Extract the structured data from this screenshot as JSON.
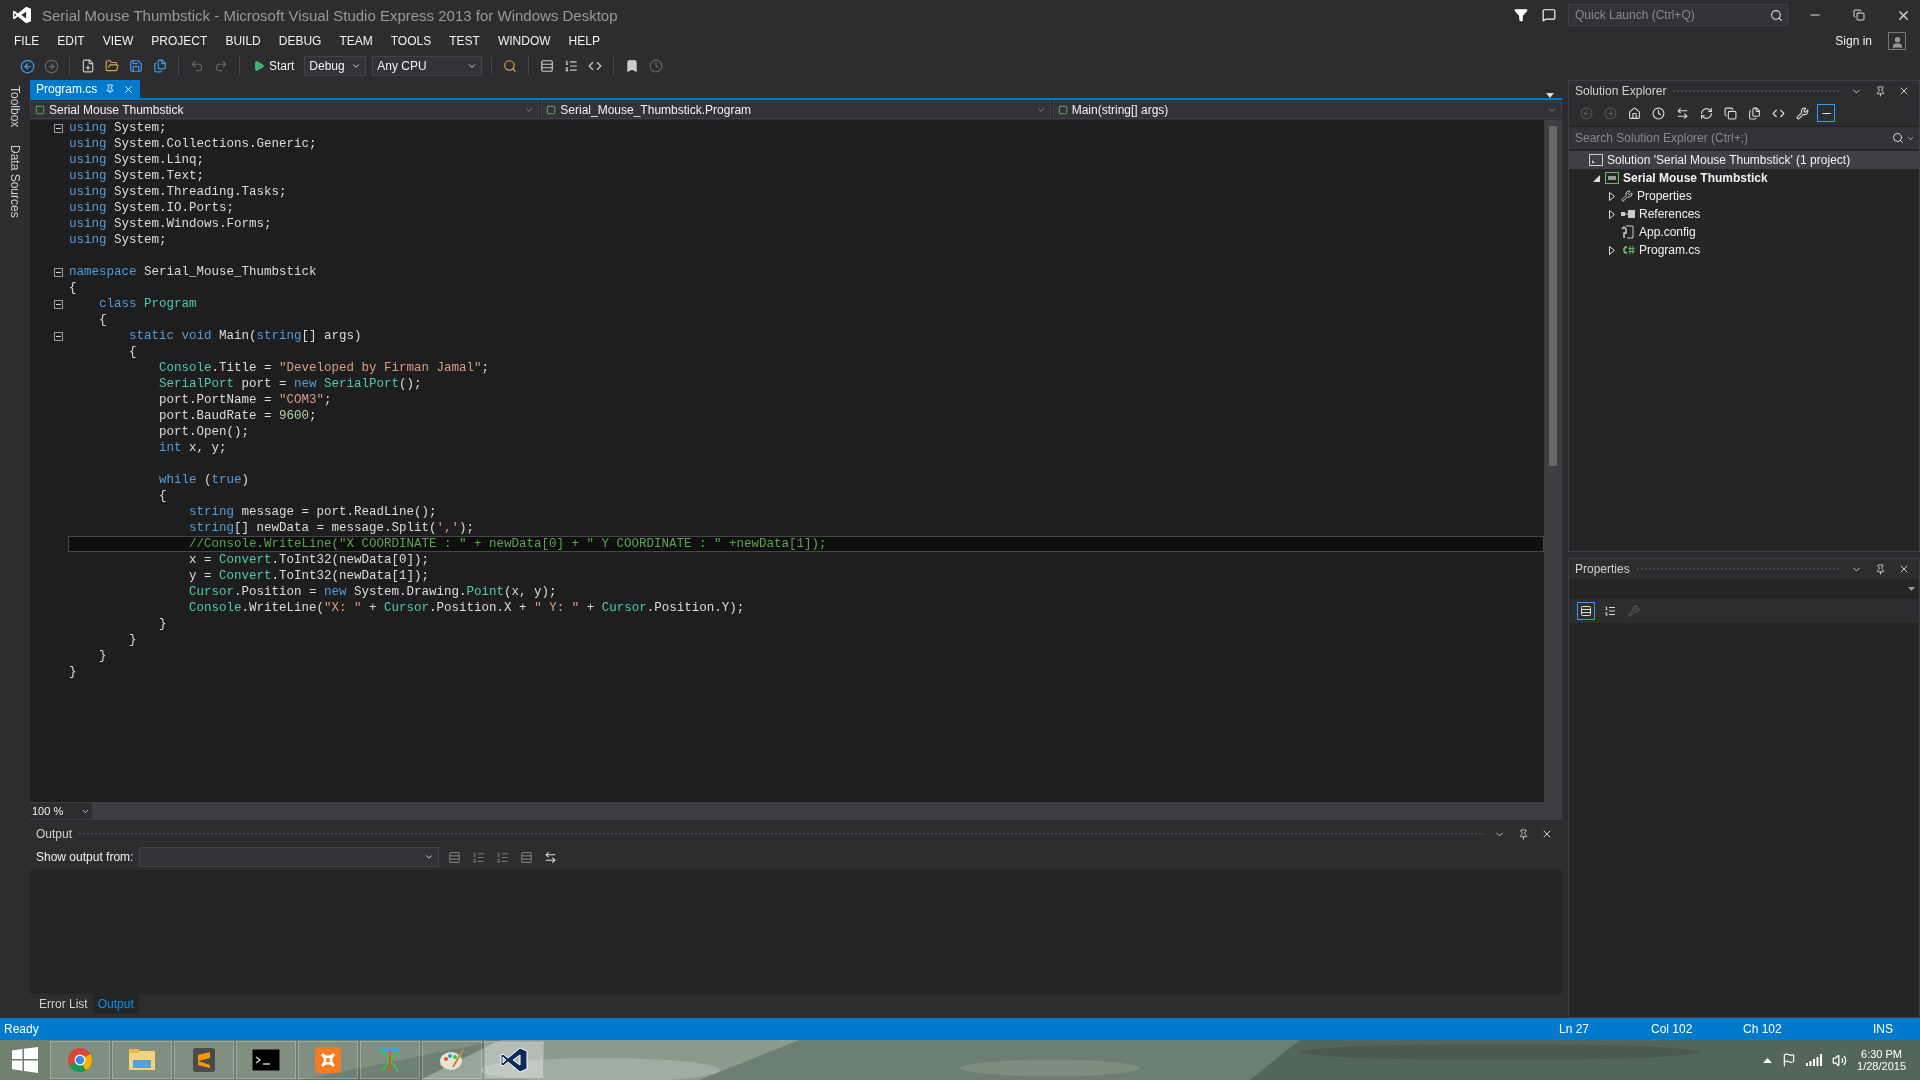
{
  "window": {
    "title": "Serial Mouse Thumbstick - Microsoft Visual Studio Express 2013 for Windows Desktop",
    "quick_launch": {
      "placeholder": "Quick Launch (Ctrl+Q)"
    },
    "sign_in": "Sign in"
  },
  "menu": [
    "FILE",
    "EDIT",
    "VIEW",
    "PROJECT",
    "BUILD",
    "DEBUG",
    "TEAM",
    "TOOLS",
    "TEST",
    "WINDOW",
    "HELP"
  ],
  "toolbar": {
    "start": "Start",
    "configuration": "Debug",
    "platform": "Any CPU"
  },
  "side_tabs": [
    "Toolbox",
    "Data Sources"
  ],
  "document_tabs": [
    {
      "label": "Program.cs",
      "selected": true
    }
  ],
  "navigation": [
    "Serial Mouse Thumbstick",
    "Serial_Mouse_Thumbstick.Program",
    "Main(string[] args)"
  ],
  "code_lines": [
    {
      "kind": "code",
      "fold": true,
      "current": false,
      "tokens": [
        {
          "kind": "kw",
          "text": "using"
        },
        {
          "kind": "p",
          "text": " System;"
        }
      ]
    },
    {
      "kind": "code",
      "fold": false,
      "current": false,
      "tokens": [
        {
          "kind": "kw",
          "text": "using"
        },
        {
          "kind": "p",
          "text": " System.Collections.Generic;"
        }
      ]
    },
    {
      "kind": "code",
      "fold": false,
      "current": false,
      "tokens": [
        {
          "kind": "kw",
          "text": "using"
        },
        {
          "kind": "p",
          "text": " System.Linq;"
        }
      ]
    },
    {
      "kind": "code",
      "fold": false,
      "current": false,
      "tokens": [
        {
          "kind": "kw",
          "text": "using"
        },
        {
          "kind": "p",
          "text": " System.Text;"
        }
      ]
    },
    {
      "kind": "code",
      "fold": false,
      "current": false,
      "tokens": [
        {
          "kind": "kw",
          "text": "using"
        },
        {
          "kind": "p",
          "text": " System.Threading.Tasks;"
        }
      ]
    },
    {
      "kind": "code",
      "fold": false,
      "current": false,
      "tokens": [
        {
          "kind": "kw",
          "text": "using"
        },
        {
          "kind": "p",
          "text": " System.IO.Ports;"
        }
      ]
    },
    {
      "kind": "code",
      "fold": false,
      "current": false,
      "tokens": [
        {
          "kind": "kw",
          "text": "using"
        },
        {
          "kind": "p",
          "text": " System.Windows.Forms;"
        }
      ]
    },
    {
      "kind": "code",
      "fold": false,
      "current": false,
      "tokens": [
        {
          "kind": "kw",
          "text": "using"
        },
        {
          "kind": "p",
          "text": " System;"
        }
      ]
    },
    {
      "kind": "blank"
    },
    {
      "kind": "code",
      "fold": true,
      "current": false,
      "tokens": [
        {
          "kind": "kw",
          "text": "namespace"
        },
        {
          "kind": "p",
          "text": " Serial_Mouse_Thumbstick"
        }
      ]
    },
    {
      "kind": "code",
      "fold": false,
      "current": false,
      "tokens": [
        {
          "kind": "p",
          "text": "{"
        }
      ]
    },
    {
      "kind": "code",
      "fold": true,
      "current": false,
      "tokens": [
        {
          "kind": "kw",
          "text": "    class "
        },
        {
          "kind": "t",
          "text": "Program"
        }
      ]
    },
    {
      "kind": "code",
      "fold": false,
      "current": false,
      "tokens": [
        {
          "kind": "p",
          "text": "    {"
        }
      ]
    },
    {
      "kind": "code",
      "fold": true,
      "current": false,
      "tokens": [
        {
          "kind": "kw",
          "text": "        static void"
        },
        {
          "kind": "p",
          "text": " Main("
        },
        {
          "kind": "kw",
          "text": "string"
        },
        {
          "kind": "p",
          "text": "[] args)"
        }
      ]
    },
    {
      "kind": "code",
      "fold": false,
      "current": false,
      "tokens": [
        {
          "kind": "p",
          "text": "        {"
        }
      ]
    },
    {
      "kind": "code",
      "fold": false,
      "current": false,
      "tokens": [
        {
          "kind": "t",
          "text": "            Console"
        },
        {
          "kind": "p",
          "text": ".Title = "
        },
        {
          "kind": "s",
          "text": "\"Developed by Firman Jamal\""
        },
        {
          "kind": "p",
          "text": ";"
        }
      ]
    },
    {
      "kind": "code",
      "fold": false,
      "current": false,
      "tokens": [
        {
          "kind": "t",
          "text": "            SerialPort"
        },
        {
          "kind": "p",
          "text": " port = "
        },
        {
          "kind": "kw",
          "text": "new "
        },
        {
          "kind": "t",
          "text": "SerialPort"
        },
        {
          "kind": "p",
          "text": "();"
        }
      ]
    },
    {
      "kind": "code",
      "fold": false,
      "current": false,
      "tokens": [
        {
          "kind": "p",
          "text": "            port.PortName = "
        },
        {
          "kind": "s",
          "text": "\"COM3\""
        },
        {
          "kind": "p",
          "text": ";"
        }
      ]
    },
    {
      "kind": "code",
      "fold": false,
      "current": false,
      "tokens": [
        {
          "kind": "p",
          "text": "            port.BaudRate = "
        },
        {
          "kind": "n",
          "text": "9600"
        },
        {
          "kind": "p",
          "text": ";"
        }
      ]
    },
    {
      "kind": "code",
      "fold": false,
      "current": false,
      "tokens": [
        {
          "kind": "p",
          "text": "            port.Open();"
        }
      ]
    },
    {
      "kind": "code",
      "fold": false,
      "current": false,
      "tokens": [
        {
          "kind": "kw",
          "text": "            int"
        },
        {
          "kind": "p",
          "text": " x, y;"
        }
      ]
    },
    {
      "kind": "blank"
    },
    {
      "kind": "code",
      "fold": false,
      "current": false,
      "tokens": [
        {
          "kind": "kw",
          "text": "            while"
        },
        {
          "kind": "p",
          "text": " ("
        },
        {
          "kind": "kw",
          "text": "true"
        },
        {
          "kind": "p",
          "text": ")"
        }
      ]
    },
    {
      "kind": "code",
      "fold": false,
      "current": false,
      "tokens": [
        {
          "kind": "p",
          "text": "            {"
        }
      ]
    },
    {
      "kind": "code",
      "fold": false,
      "current": false,
      "tokens": [
        {
          "kind": "kw",
          "text": "                string"
        },
        {
          "kind": "p",
          "text": " message = port.ReadLine();"
        }
      ]
    },
    {
      "kind": "code",
      "fold": false,
      "current": false,
      "tokens": [
        {
          "kind": "kw",
          "text": "                string"
        },
        {
          "kind": "p",
          "text": "[] newData = message.Split("
        },
        {
          "kind": "s",
          "text": "','"
        },
        {
          "kind": "p",
          "text": ");"
        }
      ]
    },
    {
      "kind": "code",
      "fold": false,
      "current": true,
      "tokens": [
        {
          "kind": "c",
          "text": "                //Console.WriteLine(\"X COORDINATE : \" + newData[0] + \" Y COORDINATE : \" +newData[1]);"
        }
      ]
    },
    {
      "kind": "code",
      "fold": false,
      "current": false,
      "tokens": [
        {
          "kind": "p",
          "text": "                x = "
        },
        {
          "kind": "t",
          "text": "Convert"
        },
        {
          "kind": "p",
          "text": ".ToInt32(newData[0]);"
        }
      ]
    },
    {
      "kind": "code",
      "fold": false,
      "current": false,
      "tokens": [
        {
          "kind": "p",
          "text": "                y = "
        },
        {
          "kind": "t",
          "text": "Convert"
        },
        {
          "kind": "p",
          "text": ".ToInt32(newData[1]);"
        }
      ]
    },
    {
      "kind": "code",
      "fold": false,
      "current": false,
      "tokens": [
        {
          "kind": "t",
          "text": "                Cursor"
        },
        {
          "kind": "p",
          "text": ".Position = "
        },
        {
          "kind": "kw",
          "text": "new"
        },
        {
          "kind": "p",
          "text": " System.Drawing."
        },
        {
          "kind": "t",
          "text": "Point"
        },
        {
          "kind": "p",
          "text": "(x, y);"
        }
      ]
    },
    {
      "kind": "code",
      "fold": false,
      "current": false,
      "tokens": [
        {
          "kind": "t",
          "text": "                Console"
        },
        {
          "kind": "p",
          "text": ".WriteLine("
        },
        {
          "kind": "s",
          "text": "\"X: \""
        },
        {
          "kind": "p",
          "text": " + "
        },
        {
          "kind": "t",
          "text": "Cursor"
        },
        {
          "kind": "p",
          "text": ".Position.X + "
        },
        {
          "kind": "s",
          "text": "\" Y: \""
        },
        {
          "kind": "p",
          "text": " + "
        },
        {
          "kind": "t",
          "text": "Cursor"
        },
        {
          "kind": "p",
          "text": ".Position.Y);"
        }
      ]
    },
    {
      "kind": "code",
      "fold": false,
      "current": false,
      "tokens": [
        {
          "kind": "p",
          "text": "            }"
        }
      ]
    },
    {
      "kind": "code",
      "fold": false,
      "current": false,
      "tokens": [
        {
          "kind": "p",
          "text": "        }"
        }
      ]
    },
    {
      "kind": "code",
      "fold": false,
      "current": false,
      "tokens": [
        {
          "kind": "p",
          "text": "    }"
        }
      ]
    },
    {
      "kind": "code",
      "fold": false,
      "current": false,
      "tokens": [
        {
          "kind": "p",
          "text": "}"
        }
      ]
    }
  ],
  "zoom": "100 %",
  "output": {
    "title": "Output",
    "show_from_label": "Show output from:"
  },
  "bottom_tabs": [
    {
      "label": "Error List",
      "selected": false
    },
    {
      "label": "Output",
      "selected": true
    }
  ],
  "solution_explorer": {
    "title": "Solution Explorer",
    "search": {
      "placeholder": "Search Solution Explorer (Ctrl+;)"
    },
    "tree": [
      {
        "kind": "solution",
        "label": "Solution 'Serial Mouse Thumbstick' (1 project)",
        "selected": true,
        "children": [
          {
            "kind": "project",
            "label": "Serial Mouse Thumbstick",
            "selected": false,
            "has_children": true,
            "expanded": true,
            "children": [
              {
                "kind": "properties",
                "label": "Properties",
                "selected": false,
                "has_children": true,
                "expanded": false
              },
              {
                "kind": "references",
                "label": "References",
                "selected": false,
                "has_children": true,
                "expanded": false
              },
              {
                "kind": "config",
                "label": "App.config",
                "selected": false,
                "has_children": false,
                "expanded": false
              },
              {
                "kind": "csharp",
                "label": "Program.cs",
                "selected": false,
                "has_children": true,
                "expanded": false
              }
            ]
          }
        ]
      }
    ]
  },
  "properties": {
    "title": "Properties"
  },
  "status_bar": {
    "message": "Ready",
    "line": "Ln 27",
    "column": "Col 102",
    "char": "Ch 102",
    "mode": "INS"
  },
  "taskbar": {
    "apps": [
      {
        "kind": "chrome",
        "selected": false
      },
      {
        "kind": "explorer",
        "selected": false
      },
      {
        "kind": "sublime",
        "selected": false
      },
      {
        "kind": "console",
        "selected": false
      },
      {
        "kind": "xampp",
        "selected": false
      },
      {
        "kind": "xtool",
        "selected": false
      },
      {
        "kind": "paint",
        "selected": false
      },
      {
        "kind": "vs",
        "selected": true
      }
    ],
    "time": "6:30 PM",
    "date": "1/28/2015"
  }
}
